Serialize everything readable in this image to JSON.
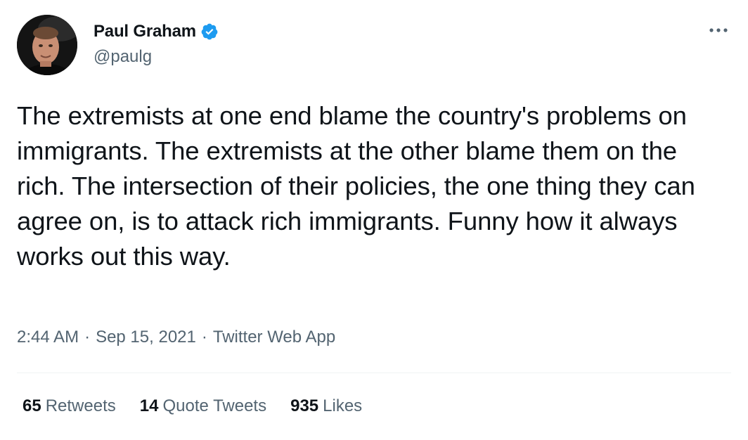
{
  "author": {
    "display_name": "Paul Graham",
    "handle": "@paulg",
    "verified": true
  },
  "tweet": {
    "text": "The extremists at one end blame the country's problems on immigrants. The extremists at the other blame them on the rich. The intersection of their policies, the one thing they can agree on, is to attack rich immigrants. Funny how it always works out this way.",
    "time": "2:44 AM",
    "date": "Sep 15, 2021",
    "source": "Twitter Web App",
    "separator": "·"
  },
  "stats": {
    "retweets_count": "65",
    "retweets_label": "Retweets",
    "quotes_count": "14",
    "quotes_label": "Quote Tweets",
    "likes_count": "935",
    "likes_label": "Likes"
  },
  "colors": {
    "text_primary": "#0f1419",
    "text_secondary": "#536471",
    "verified_blue": "#1d9bf0",
    "divider": "#eff3f4"
  },
  "icons": {
    "verified": "verified-badge-icon",
    "more": "more-horizontal-icon"
  }
}
